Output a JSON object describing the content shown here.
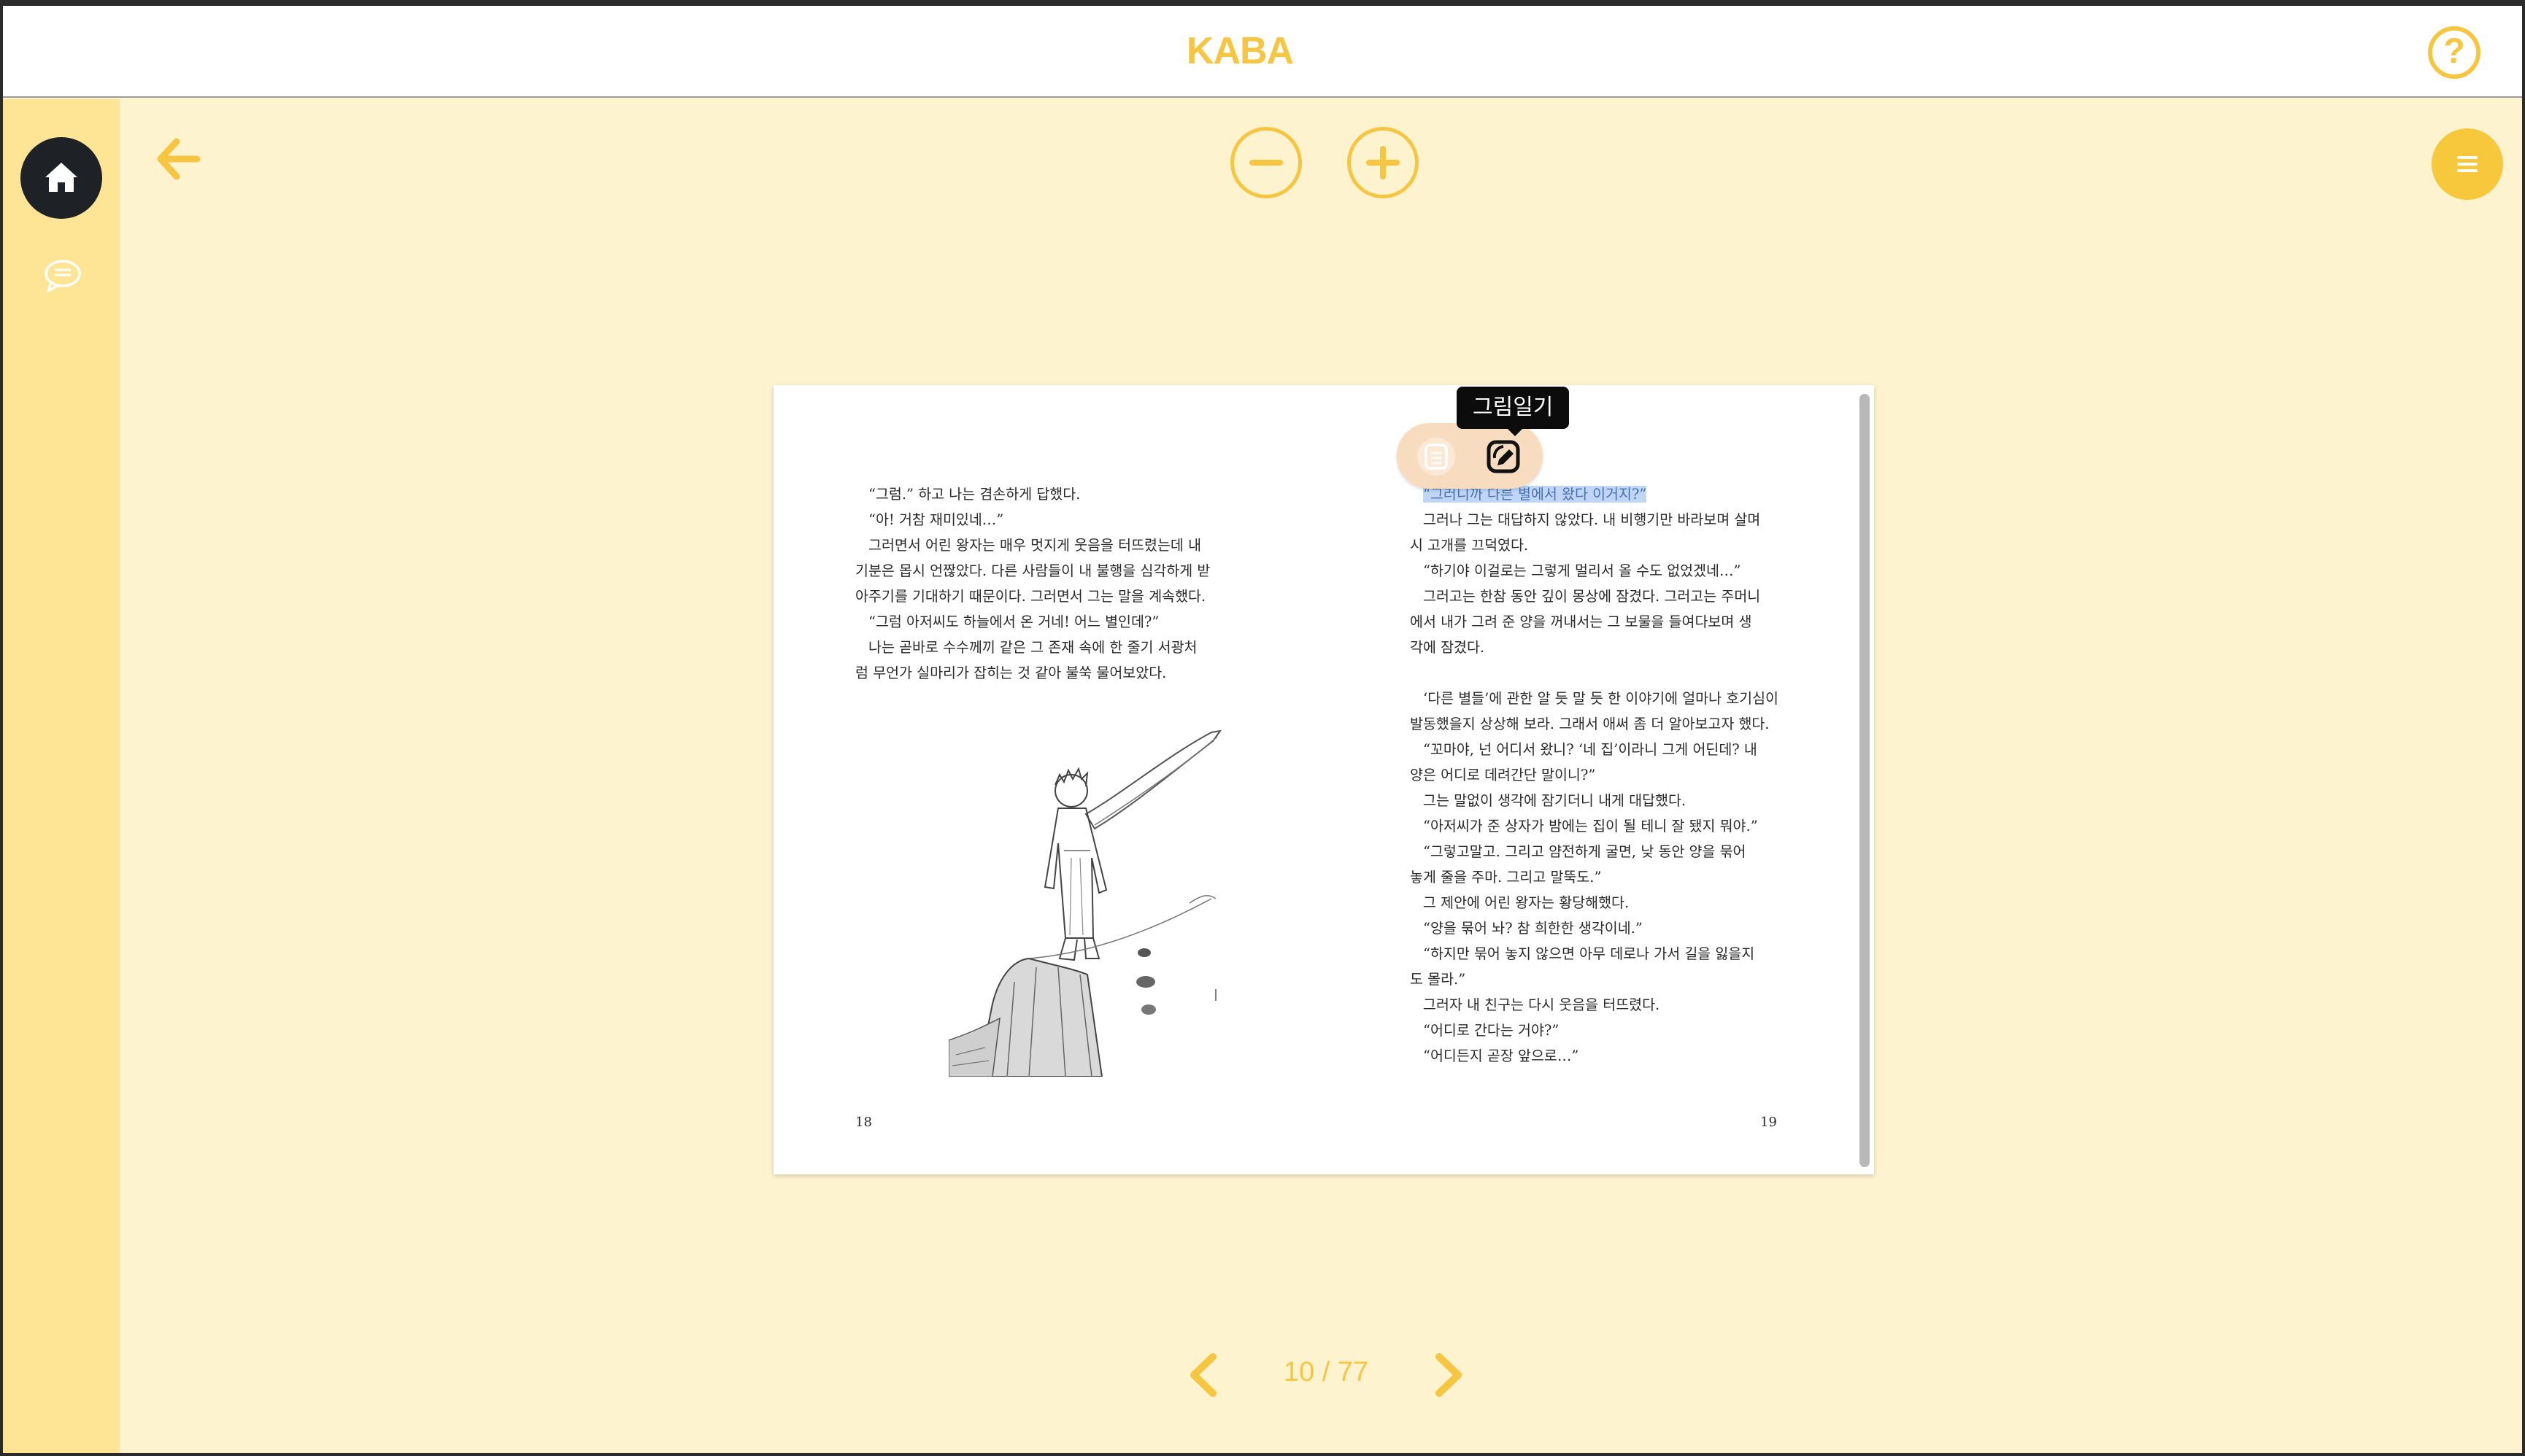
{
  "app": {
    "title": "KABA",
    "help_icon": "question-circle-icon",
    "accent_color": "#f6c542",
    "background_color": "#fdf3cf",
    "sidebar_color": "#fde595"
  },
  "sidebar": {
    "items": [
      {
        "name": "home",
        "icon": "home-icon",
        "active": true
      },
      {
        "name": "comments",
        "icon": "chat-bubble-icon",
        "active": false
      }
    ]
  },
  "toolbar": {
    "back_icon": "arrow-left-icon",
    "zoom_out_icon": "minus-circle-icon",
    "zoom_in_icon": "plus-circle-icon",
    "menu_icon": "hamburger-menu-icon"
  },
  "book": {
    "left_page": {
      "number": "18",
      "lines": [
        "“그럼.” 하고 나는 겸손하게 답했다.",
        "“아! 거참 재미있네…”",
        "그러면서 어린 왕자는 매우 멋지게 웃음을 터뜨렸는데 내",
        "기분은 몹시 언짢았다. 다른 사람들이 내 불행을 심각하게 받",
        "아주기를 기대하기 때문이다. 그러면서 그는 말을 계속했다.",
        "“그럼 아저씨도 하늘에서 온 거네! 어느 별인데?”",
        "나는 곧바로 수수께끼 같은 그 존재 속에 한 줄기 서광처",
        "럼 무언가 실마리가 잡히는 것 같아 불쑥 물어보았다."
      ]
    },
    "right_page": {
      "number": "19",
      "highlighted_line": "“그러니까 다른 별에서 왔다 이거지?”",
      "lines_before_break": [
        "그러나 그는 대답하지 않았다. 내 비행기만 바라보며 살며",
        "시 고개를 끄덕였다.",
        "“하기야 이걸로는 그렇게 멀리서 올 수도 없었겠네…”",
        "그러고는 한참 동안 깊이 몽상에 잠겼다. 그러고는 주머니",
        "에서 내가 그려 준 양을 꺼내서는 그 보물을 들여다보며 생",
        "각에 잠겼다."
      ],
      "lines_after_break": [
        "‘다른 별들’에 관한 알 듯 말 듯 한 이야기에 얼마나 호기심이",
        "발동했을지 상상해 보라. 그래서 애써 좀 더 알아보고자 했다.",
        "“꼬마야, 넌 어디서 왔니? ‘네 집’이라니 그게 어딘데? 내",
        "양은 어디로 데려간단 말이니?”",
        "그는 말없이 생각에 잠기더니 내게 대답했다.",
        "“아저씨가 준 상자가 밤에는 집이 될 테니 잘 됐지 뭐야.”",
        "“그렇고말고. 그리고 얌전하게 굴면, 낮 동안 양을 묶어",
        "놓게 줄을 주마. 그리고 말뚝도.”",
        "그 제안에 어린 왕자는 황당해했다.",
        "“양을 묶어 놔? 참 희한한 생각이네.”",
        "“하지만 묶어 놓지 않으면 아무 데로나 가서 길을 잃을지",
        "도 몰라.”",
        "그러자 내 친구는 다시 웃음을 터뜨렸다.",
        "“어디로 간다는 거야?”",
        "“어디든지 곧장 앞으로…”"
      ]
    },
    "illustration": "little-prince-on-cliff-illustration"
  },
  "selection_popup": {
    "notes_icon": "note-list-icon",
    "drawing_icon": "drawing-diary-icon",
    "tooltip": "그림일기"
  },
  "pagination": {
    "current": 10,
    "total": 77,
    "label": "10 / 77",
    "prev_icon": "chevron-left-icon",
    "next_icon": "chevron-right-icon"
  }
}
